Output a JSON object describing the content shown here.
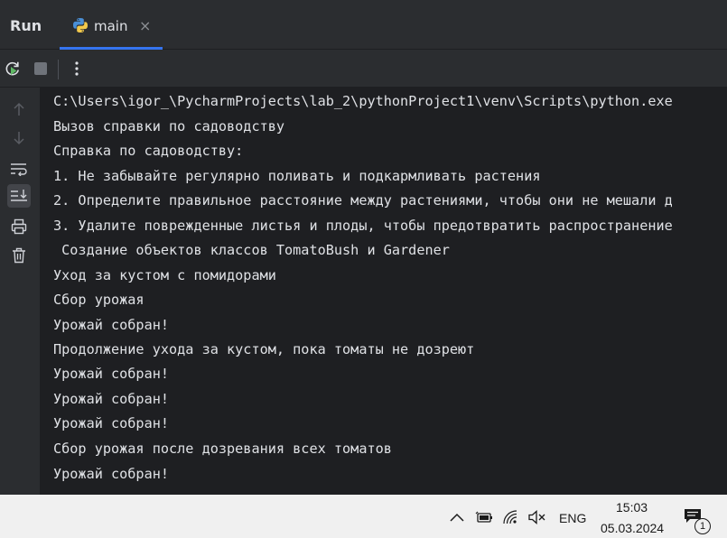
{
  "header": {
    "title": "Run",
    "tab": {
      "label": "main",
      "close": "×"
    }
  },
  "console": {
    "lines": [
      "C:\\Users\\igor_\\PycharmProjects\\lab_2\\pythonProject1\\venv\\Scripts\\python.exe",
      "Вызов справки по садоводству",
      "Справка по садоводству:",
      "1. Не забывайте регулярно поливать и подкармливать растения",
      "2. Определите правильное расстояние между растениями, чтобы они не мешали д",
      "3. Удалите поврежденные листья и плоды, чтобы предотвратить распространение",
      " Создание объектов классов TomatoBush и Gardener",
      "Уход за кустом с помидорами",
      "Сбор урожая",
      "Урожай собран!",
      "Продолжение ухода за кустом, пока томаты не дозреют",
      "Урожай собран!",
      "Урожай собран!",
      "Урожай собран!",
      "Сбор урожая после дозревания всех томатов",
      "Урожай собран!"
    ]
  },
  "taskbar": {
    "language": "ENG",
    "time": "15:03",
    "date": "05.03.2024",
    "notification_count": "1"
  },
  "colors": {
    "accent": "#3574f0",
    "rerun_green": "#5fb865",
    "console_bg": "#1e1f22",
    "panel_bg": "#2b2d30"
  },
  "icons": {
    "toolbar": [
      "rerun-icon",
      "stop-icon",
      "more-options-icon"
    ],
    "gutter": [
      "scroll-up-icon",
      "scroll-down-icon",
      "soft-wrap-icon",
      "scroll-to-end-icon",
      "print-icon",
      "trash-icon"
    ],
    "tray": [
      "chevron-up-icon",
      "battery-icon",
      "wifi-icon",
      "volume-mute-icon",
      "notification-icon"
    ]
  }
}
